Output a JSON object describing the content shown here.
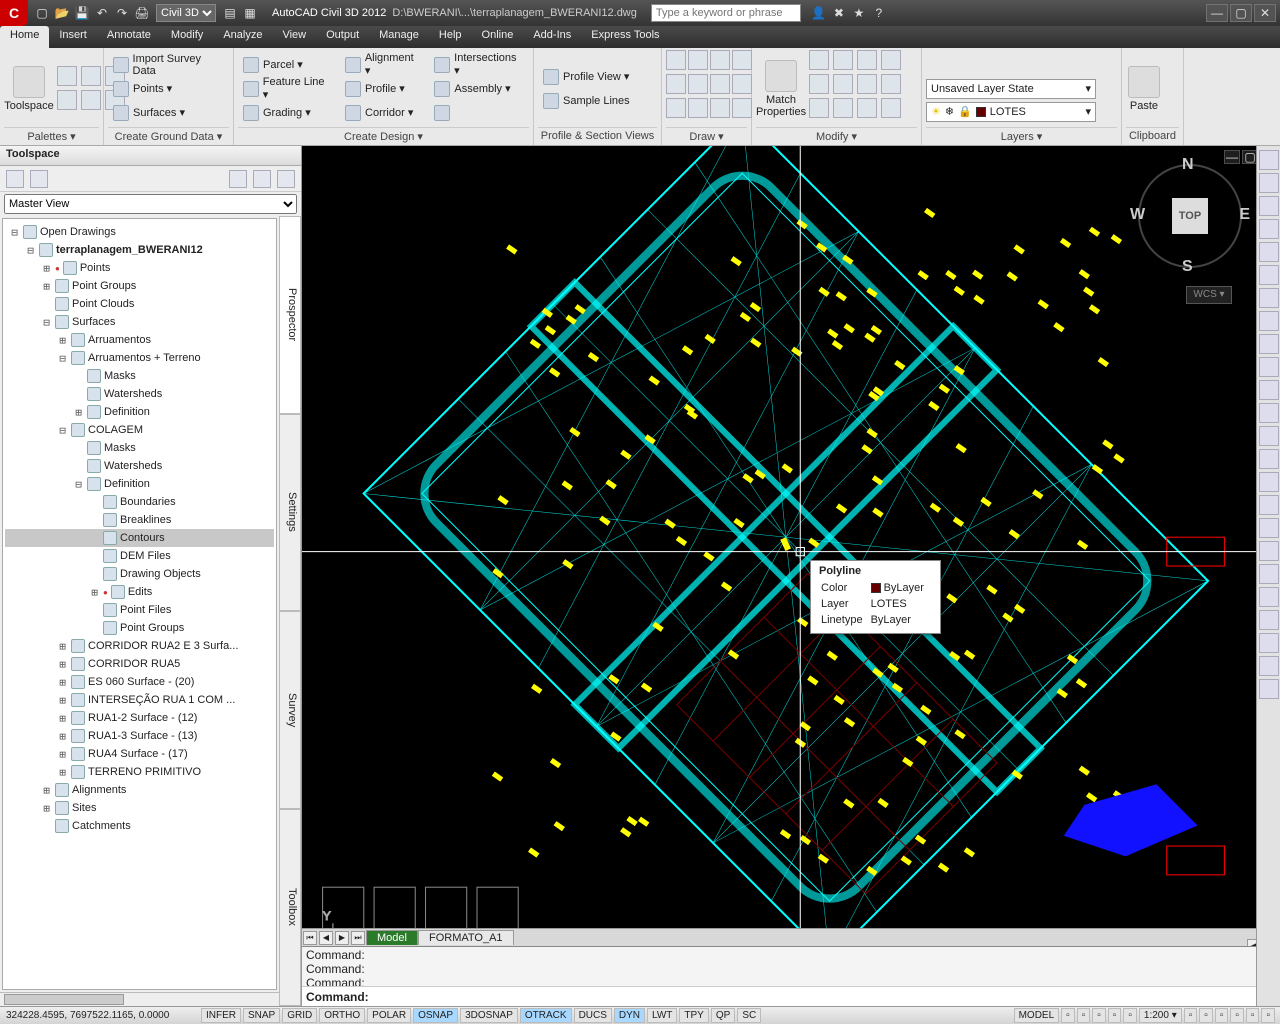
{
  "title": {
    "workspace": "Civil 3D",
    "app": "AutoCAD Civil 3D 2012",
    "path": "D:\\BWERANI\\...\\terraplanagem_BWERANI12.dwg",
    "search_ph": "Type a keyword or phrase"
  },
  "tabs": [
    "Home",
    "Insert",
    "Annotate",
    "Modify",
    "Analyze",
    "View",
    "Output",
    "Manage",
    "Help",
    "Online",
    "Add-Ins",
    "Express Tools"
  ],
  "ribbon": {
    "palettes": {
      "big": "Toolspace",
      "title": "Palettes ▾"
    },
    "ground": {
      "items": [
        "Import Survey Data",
        "Points ▾",
        "Surfaces ▾"
      ],
      "title": "Create Ground Data ▾"
    },
    "design": {
      "c1": [
        "Parcel ▾",
        "Feature Line ▾",
        "Grading ▾"
      ],
      "c2": [
        "Alignment ▾",
        "Profile ▾",
        "Corridor ▾"
      ],
      "c3": [
        "Intersections ▾",
        "Assembly ▾",
        ""
      ],
      "title": "Create Design ▾"
    },
    "profile": {
      "items": [
        "Profile View ▾",
        "Sample Lines"
      ],
      "title": "Profile & Section Views"
    },
    "draw": {
      "title": "Draw ▾"
    },
    "modify": {
      "big": "Match\nProperties",
      "title": "Modify ▾"
    },
    "layers": {
      "state": "Unsaved Layer State",
      "layer": "LOTES",
      "title": "Layers ▾"
    },
    "clip": {
      "big": "Paste",
      "title": "Clipboard"
    }
  },
  "toolspace": {
    "title": "Toolspace",
    "view": "Master View",
    "sidetabs": [
      "Prospector",
      "Settings",
      "Survey",
      "Toolbox"
    ],
    "tree": [
      {
        "d": 0,
        "t": "⊟",
        "l": "Open Drawings",
        "i": "folder"
      },
      {
        "d": 1,
        "t": "⊟",
        "l": "terraplanagem_BWERANI12",
        "i": "dwg",
        "bold": true
      },
      {
        "d": 2,
        "t": "⊞",
        "l": "Points",
        "i": "pt",
        "dot": true
      },
      {
        "d": 2,
        "t": "⊞",
        "l": "Point Groups",
        "i": "pg"
      },
      {
        "d": 2,
        "t": "",
        "l": "Point Clouds",
        "i": "pc"
      },
      {
        "d": 2,
        "t": "⊟",
        "l": "Surfaces",
        "i": "srf"
      },
      {
        "d": 3,
        "t": "⊞",
        "l": "Arruamentos",
        "i": "tin"
      },
      {
        "d": 3,
        "t": "⊟",
        "l": "Arruamentos + Terreno",
        "i": "tin"
      },
      {
        "d": 4,
        "t": "",
        "l": "Masks",
        "i": "msk"
      },
      {
        "d": 4,
        "t": "",
        "l": "Watersheds",
        "i": "wsh"
      },
      {
        "d": 4,
        "t": "⊞",
        "l": "Definition",
        "i": "def"
      },
      {
        "d": 3,
        "t": "⊟",
        "l": "COLAGEM",
        "i": "tin"
      },
      {
        "d": 4,
        "t": "",
        "l": "Masks",
        "i": "msk"
      },
      {
        "d": 4,
        "t": "",
        "l": "Watersheds",
        "i": "wsh"
      },
      {
        "d": 4,
        "t": "⊟",
        "l": "Definition",
        "i": "def"
      },
      {
        "d": 5,
        "t": "",
        "l": "Boundaries",
        "i": "bnd"
      },
      {
        "d": 5,
        "t": "",
        "l": "Breaklines",
        "i": "brk"
      },
      {
        "d": 5,
        "t": "",
        "l": "Contours",
        "i": "cnt",
        "sel": true
      },
      {
        "d": 5,
        "t": "",
        "l": "DEM Files",
        "i": "dem"
      },
      {
        "d": 5,
        "t": "",
        "l": "Drawing Objects",
        "i": "drw"
      },
      {
        "d": 5,
        "t": "⊞",
        "l": "Edits",
        "i": "edt",
        "dot": true
      },
      {
        "d": 5,
        "t": "",
        "l": "Point Files",
        "i": "ptf"
      },
      {
        "d": 5,
        "t": "",
        "l": "Point Groups",
        "i": "pg"
      },
      {
        "d": 3,
        "t": "⊞",
        "l": "CORRIDOR RUA2 E 3 Surfa...",
        "i": "tin"
      },
      {
        "d": 3,
        "t": "⊞",
        "l": "CORRIDOR RUA5",
        "i": "tin"
      },
      {
        "d": 3,
        "t": "⊞",
        "l": "ES 060 Surface - (20)",
        "i": "tin"
      },
      {
        "d": 3,
        "t": "⊞",
        "l": "INTERSEÇÃO RUA 1 COM ...",
        "i": "tin"
      },
      {
        "d": 3,
        "t": "⊞",
        "l": "RUA1-2 Surface - (12)",
        "i": "tin"
      },
      {
        "d": 3,
        "t": "⊞",
        "l": "RUA1-3 Surface - (13)",
        "i": "tin"
      },
      {
        "d": 3,
        "t": "⊞",
        "l": "RUA4 Surface - (17)",
        "i": "tin"
      },
      {
        "d": 3,
        "t": "⊞",
        "l": "TERRENO PRIMITIVO",
        "i": "tin"
      },
      {
        "d": 2,
        "t": "⊞",
        "l": "Alignments",
        "i": "aln"
      },
      {
        "d": 2,
        "t": "⊞",
        "l": "Sites",
        "i": "sit"
      },
      {
        "d": 2,
        "t": "",
        "l": "Catchments",
        "i": "cat"
      }
    ]
  },
  "viewcube": {
    "top": "TOP",
    "n": "N",
    "s": "S",
    "e": "E",
    "w": "W",
    "wcs": "WCS ▾"
  },
  "tooltip": {
    "title": "Polyline",
    "rows": [
      [
        "Color",
        "ByLayer"
      ],
      [
        "Layer",
        "LOTES"
      ],
      [
        "Linetype",
        "ByLayer"
      ]
    ]
  },
  "mtabs": {
    "active": "Model",
    "other": "FORMATO_A1"
  },
  "cmd": {
    "hist": [
      "Command:",
      "Command:",
      "Command:"
    ],
    "label": "Command:"
  },
  "status": {
    "coords": "324228.4595, 7697522.1165, 0.0000",
    "btns": [
      [
        "INFER",
        0
      ],
      [
        "SNAP",
        0
      ],
      [
        "GRID",
        0
      ],
      [
        "ORTHO",
        0
      ],
      [
        "POLAR",
        0
      ],
      [
        "OSNAP",
        1
      ],
      [
        "3DOSNAP",
        0
      ],
      [
        "OTRACK",
        1
      ],
      [
        "DUCS",
        0
      ],
      [
        "DYN",
        1
      ],
      [
        "LWT",
        0
      ],
      [
        "TPY",
        0
      ],
      [
        "QP",
        0
      ],
      [
        "SC",
        0
      ]
    ],
    "right": [
      "MODEL",
      "",
      "",
      "",
      "",
      "",
      "1:200 ▾",
      "",
      "",
      "",
      "",
      "",
      ""
    ]
  }
}
